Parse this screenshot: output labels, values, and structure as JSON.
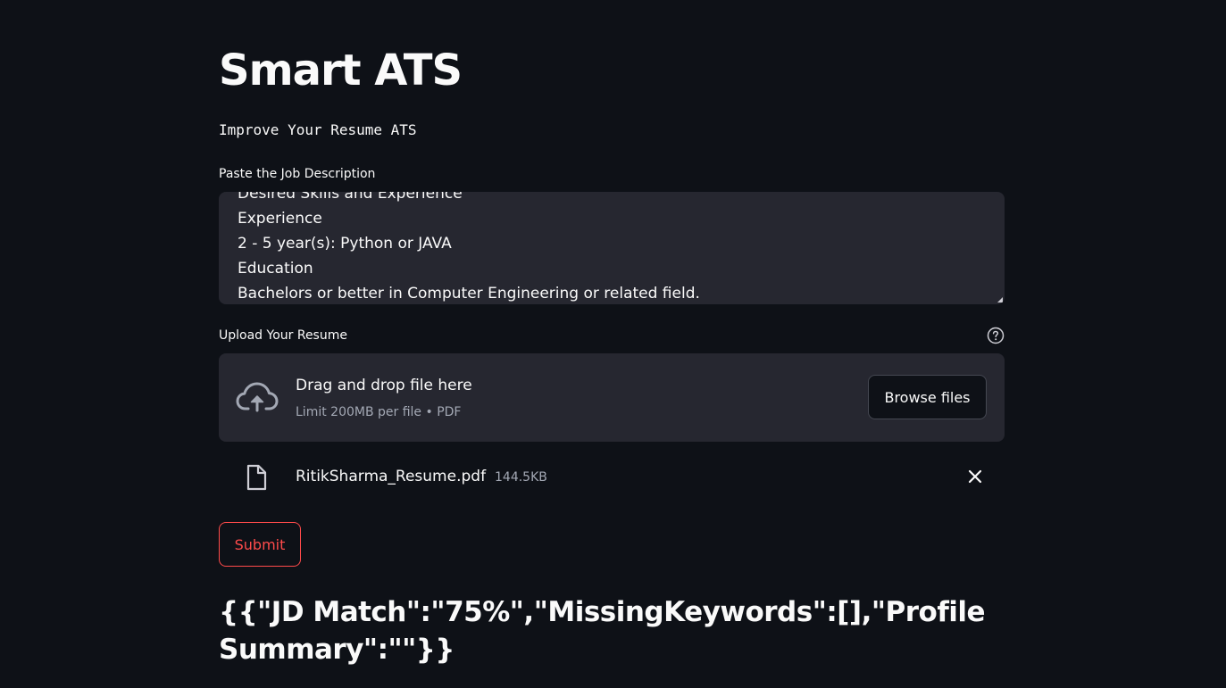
{
  "header": {
    "title": "Smart ATS",
    "subtitle": "Improve Your Resume ATS"
  },
  "job_description": {
    "label": "Paste the Job Description",
    "value": "Desired Skills and Experience\nExperience\n2 - 5 year(s): Python or JAVA\nEducation\nBachelors or better in Computer Engineering or related field."
  },
  "uploader": {
    "label": "Upload Your Resume",
    "drop_title": "Drag and drop file here",
    "limit_text": "Limit 200MB per file • PDF",
    "browse_label": "Browse files",
    "file": {
      "name": "RitikSharma_Resume.pdf",
      "size": "144.5KB"
    }
  },
  "form": {
    "submit_label": "Submit"
  },
  "result": {
    "text": "{{\"JD Match\":\"75%\",\"MissingKeywords\":[],\"Profile Summary\":\"\"}}"
  },
  "theme": {
    "background": "#0e1117",
    "surface": "#262730",
    "primary": "#ff4b4b",
    "text": "#fafafa",
    "muted": "#a3a8b4"
  },
  "icons": {
    "help": "question-circle-icon",
    "upload": "cloud-upload-icon",
    "file": "file-icon",
    "remove": "close-icon"
  }
}
